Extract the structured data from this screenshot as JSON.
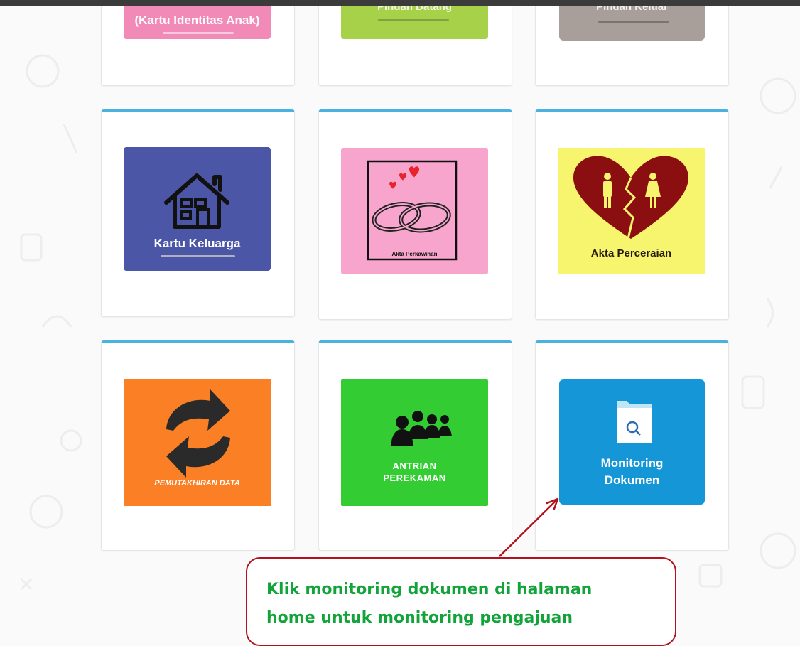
{
  "tiles": {
    "kia": {
      "label": "(Kartu Identitas Anak)",
      "color": "#f28ab8"
    },
    "pindah_datang": {
      "label": "Pindah Datang",
      "color": "#a8d14a"
    },
    "pindah_keluar": {
      "label": "Pindah Keluar",
      "color": "#a89e9a"
    },
    "kartu_keluarga": {
      "label": "Kartu Keluarga",
      "color": "#4b57a6",
      "icon": "house-icon"
    },
    "akta_perkawinan": {
      "label": "Akta Perkawinan",
      "color": "#f7a5cd",
      "icon": "wedding-rings-icon"
    },
    "akta_perceraian": {
      "label": "Akta Perceraian",
      "color": "#f7f56e",
      "icon": "broken-heart-icon"
    },
    "pemutakhiran_data": {
      "label": "PEMUTAKHIRAN DATA",
      "color": "#fb7f24",
      "icon": "refresh-arrows-icon"
    },
    "antrian_perekaman": {
      "label_line1": "ANTRIAN",
      "label_line2": "PEREKAMAN",
      "color": "#33cc33",
      "icon": "people-group-icon"
    },
    "monitoring_dokumen": {
      "label_line1": "Monitoring",
      "label_line2": "Dokumen",
      "color": "#1596d6",
      "icon": "folder-search-icon"
    }
  },
  "callout": {
    "line1": "Klik monitoring dokumen di halaman",
    "line2": "home untuk monitoring pengajuan",
    "border_color": "#b0131d",
    "text_color": "#12a43a"
  }
}
